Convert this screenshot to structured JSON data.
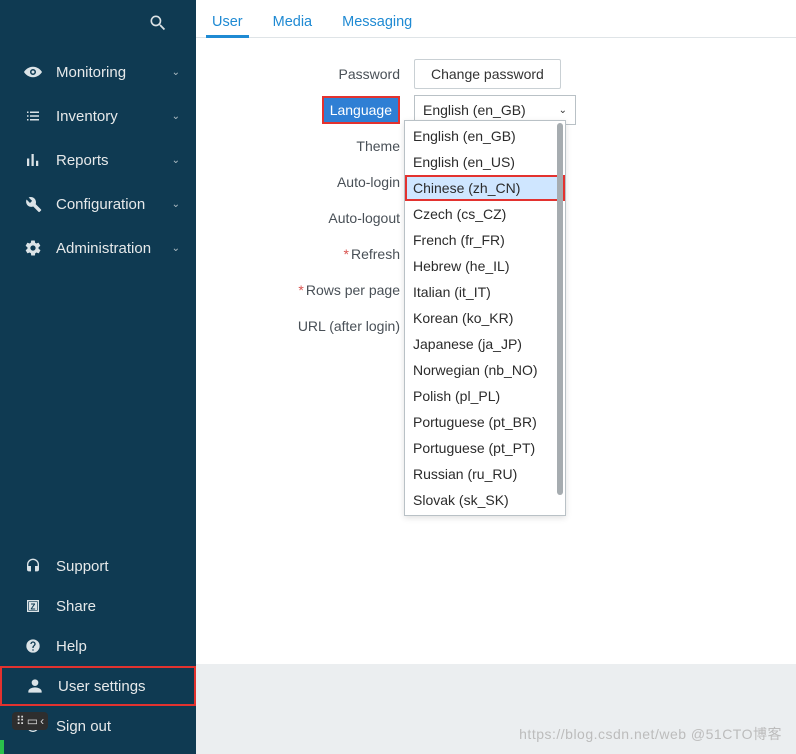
{
  "sidebar": {
    "nav": [
      {
        "label": "Monitoring"
      },
      {
        "label": "Inventory"
      },
      {
        "label": "Reports"
      },
      {
        "label": "Configuration"
      },
      {
        "label": "Administration"
      }
    ],
    "bottom": [
      {
        "label": "Support"
      },
      {
        "label": "Share"
      },
      {
        "label": "Help"
      },
      {
        "label": "User settings"
      },
      {
        "label": "Sign out"
      }
    ]
  },
  "tabs": [
    {
      "label": "User"
    },
    {
      "label": "Media"
    },
    {
      "label": "Messaging"
    }
  ],
  "form": {
    "password_label": "Password",
    "change_password_btn": "Change password",
    "language_label": "Language",
    "language_value": "English (en_GB)",
    "theme_label": "Theme",
    "autologin_label": "Auto-login",
    "autologout_label": "Auto-logout",
    "refresh_label": "Refresh",
    "rows_label": "Rows per page",
    "url_label": "URL (after login)"
  },
  "language_options": [
    "English (en_GB)",
    "English (en_US)",
    "Chinese (zh_CN)",
    "Czech (cs_CZ)",
    "French (fr_FR)",
    "Hebrew (he_IL)",
    "Italian (it_IT)",
    "Korean (ko_KR)",
    "Japanese (ja_JP)",
    "Norwegian (nb_NO)",
    "Polish (pl_PL)",
    "Portuguese (pt_BR)",
    "Portuguese (pt_PT)",
    "Russian (ru_RU)",
    "Slovak (sk_SK)"
  ],
  "highlight_option_index": 2,
  "watermark": "https://blog.csdn.net/web  @51CTO博客"
}
